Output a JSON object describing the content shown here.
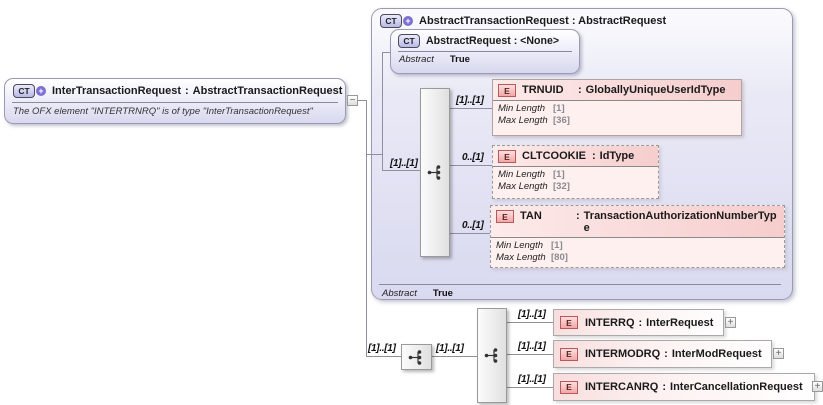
{
  "sep": ":",
  "icons": {
    "complex_type": "CT",
    "element": "E",
    "expand": "+",
    "collapse": "−"
  },
  "root_box": {
    "name": "InterTransactionRequest",
    "type": "AbstractTransactionRequest",
    "annotation": "The OFX element \"INTERTRNRQ\" is of type \"InterTransactionRequest\""
  },
  "parent_box": {
    "title": "AbstractTransactionRequest : AbstractRequest",
    "abstract_label": "Abstract",
    "abstract_value": "True",
    "base_box": {
      "title": "AbstractRequest : <None>",
      "abstract_label": "Abstract",
      "abstract_value": "True"
    },
    "group_cardinality": "[1]..[1]",
    "elements": [
      {
        "name": "TRNUID",
        "type": "GloballyUniqueUserIdType",
        "cardinality": "[1]..[1]",
        "facets": [
          {
            "label": "Min Length",
            "value": "[1]"
          },
          {
            "label": "Max Length",
            "value": "[36]"
          }
        ]
      },
      {
        "name": "CLTCOOKIE",
        "type": "IdType",
        "cardinality": "0..[1]",
        "facets": [
          {
            "label": "Min Length",
            "value": "[1]"
          },
          {
            "label": "Max Length",
            "value": "[32]"
          }
        ]
      },
      {
        "name": "TAN",
        "type": "TransactionAuthorizationNumberType",
        "cardinality": "0..[1]",
        "facets": [
          {
            "label": "Min Length",
            "value": "[1]"
          },
          {
            "label": "Max Length",
            "value": "[80]"
          }
        ]
      }
    ]
  },
  "bottom_group": {
    "outer_cardinality": "[1]..[1]",
    "inner_cardinality": "[1]..[1]",
    "elements": [
      {
        "name": "INTERRQ",
        "type": "InterRequest",
        "cardinality": "[1]..[1]"
      },
      {
        "name": "INTERMODRQ",
        "type": "InterModRequest",
        "cardinality": "[1]..[1]"
      },
      {
        "name": "INTERCANRQ",
        "type": "InterCancellationRequest",
        "cardinality": "[1]..[1]"
      }
    ]
  }
}
